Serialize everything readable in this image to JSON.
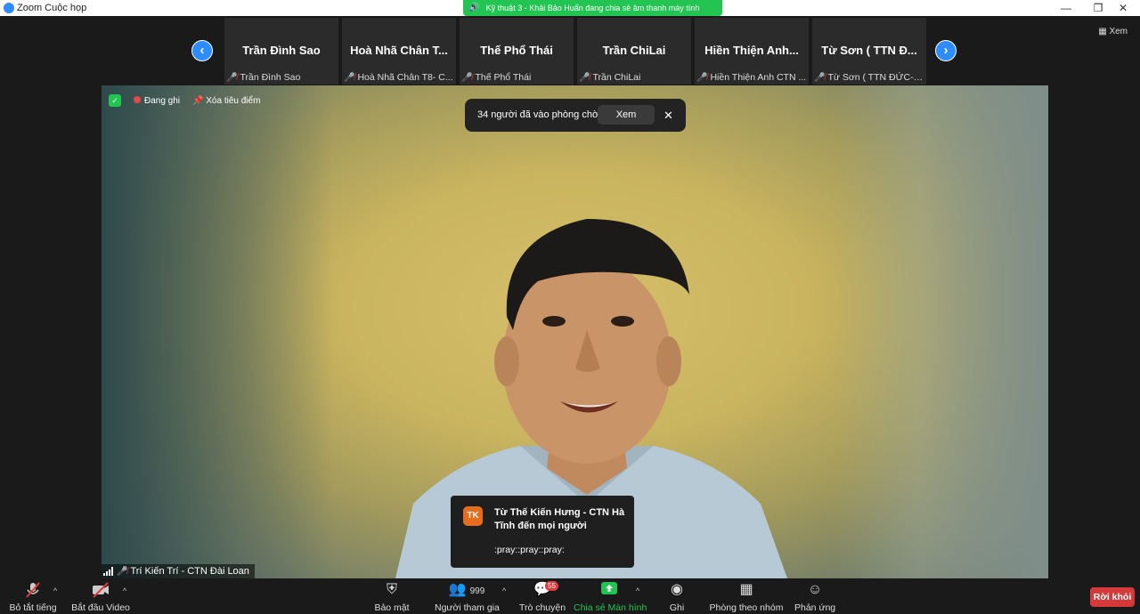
{
  "window": {
    "title": "Zoom Cuộc họp"
  },
  "share_banner": {
    "text": "Kỹ thuật 3 - Khải Bảo Huấn đang chia sẻ âm thanh máy tính"
  },
  "strip": {
    "view_label": "Xem",
    "tiles": [
      {
        "name": "Trần Đình Sao",
        "label": "Trần Đình Sao"
      },
      {
        "name": "Hoà Nhã Chân T...",
        "label": "Hoà Nhã Chân T8- C..."
      },
      {
        "name": "Thế Phổ Thái",
        "label": "Thế Phổ Thái"
      },
      {
        "name": "Trần ChiLai",
        "label": "Trần ChiLai"
      },
      {
        "name": "Hiền Thiện Anh...",
        "label": "Hiền Thiện Anh CTN ..."
      },
      {
        "name": "Từ Sơn ( TTN Đ...",
        "label": "Từ Sơn ( TTN ĐỨC- N..."
      }
    ]
  },
  "video": {
    "recording_label": "Đang ghi",
    "remove_spotlight_label": "Xóa tiêu điểm",
    "speaker_name": "Trí Kiến Trí - CTN Đài Loan"
  },
  "waiting_room": {
    "text": "34 người đã vào phòng chờ",
    "view_button": "Xem"
  },
  "chat_popup": {
    "avatar_initials": "TK",
    "sender": "Từ Thế Kiến Hưng - CTN Hà Tĩnh đến mọi người",
    "message": ":pray::pray::pray:"
  },
  "toolbar": {
    "unmute": "Bỏ tắt tiếng",
    "start_video": "Bắt đầu Video",
    "security": "Bảo mật",
    "participants": "Người tham gia",
    "participants_count": "999",
    "chat": "Trò chuyện",
    "chat_badge": "55",
    "share_screen": "Chia sẻ Màn hình",
    "record": "Ghi",
    "breakout": "Phòng theo nhóm",
    "reactions": "Phản ứng",
    "leave": "Rời khỏi"
  },
  "colors": {
    "accent": "#2d8cff",
    "green": "#23c552",
    "leave": "#d43a3a",
    "badge": "#e03a3a"
  }
}
